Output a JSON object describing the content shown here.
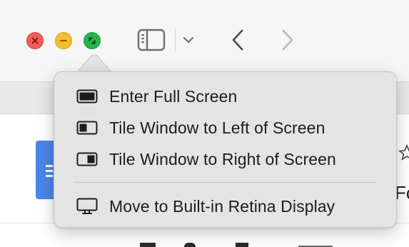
{
  "window": {
    "traffic_lights": [
      {
        "name": "close",
        "color": "#ef5f58",
        "icon": "close-x-icon"
      },
      {
        "name": "minimize",
        "color": "#f7bd2e",
        "icon": "minus-icon"
      },
      {
        "name": "zoom",
        "color": "#27b44d",
        "icon": "fullscreen-arrows-icon"
      }
    ]
  },
  "toolbar": {
    "icons": [
      "sidebar-icon",
      "chevron-down-icon",
      "chevron-left-icon",
      "chevron-right-icon"
    ]
  },
  "zoom_menu": {
    "items": [
      {
        "label": "Enter Full Screen",
        "icon": "full-screen-icon"
      },
      {
        "label": "Tile Window to Left of Screen",
        "icon": "tile-left-icon"
      },
      {
        "label": "Tile Window to Right of Screen",
        "icon": "tile-right-icon"
      },
      {
        "label": "Move to Built-in Retina Display",
        "icon": "display-icon"
      }
    ]
  },
  "background": {
    "cut_text": "Fc",
    "doc_icon_color": "#4a86e8"
  }
}
